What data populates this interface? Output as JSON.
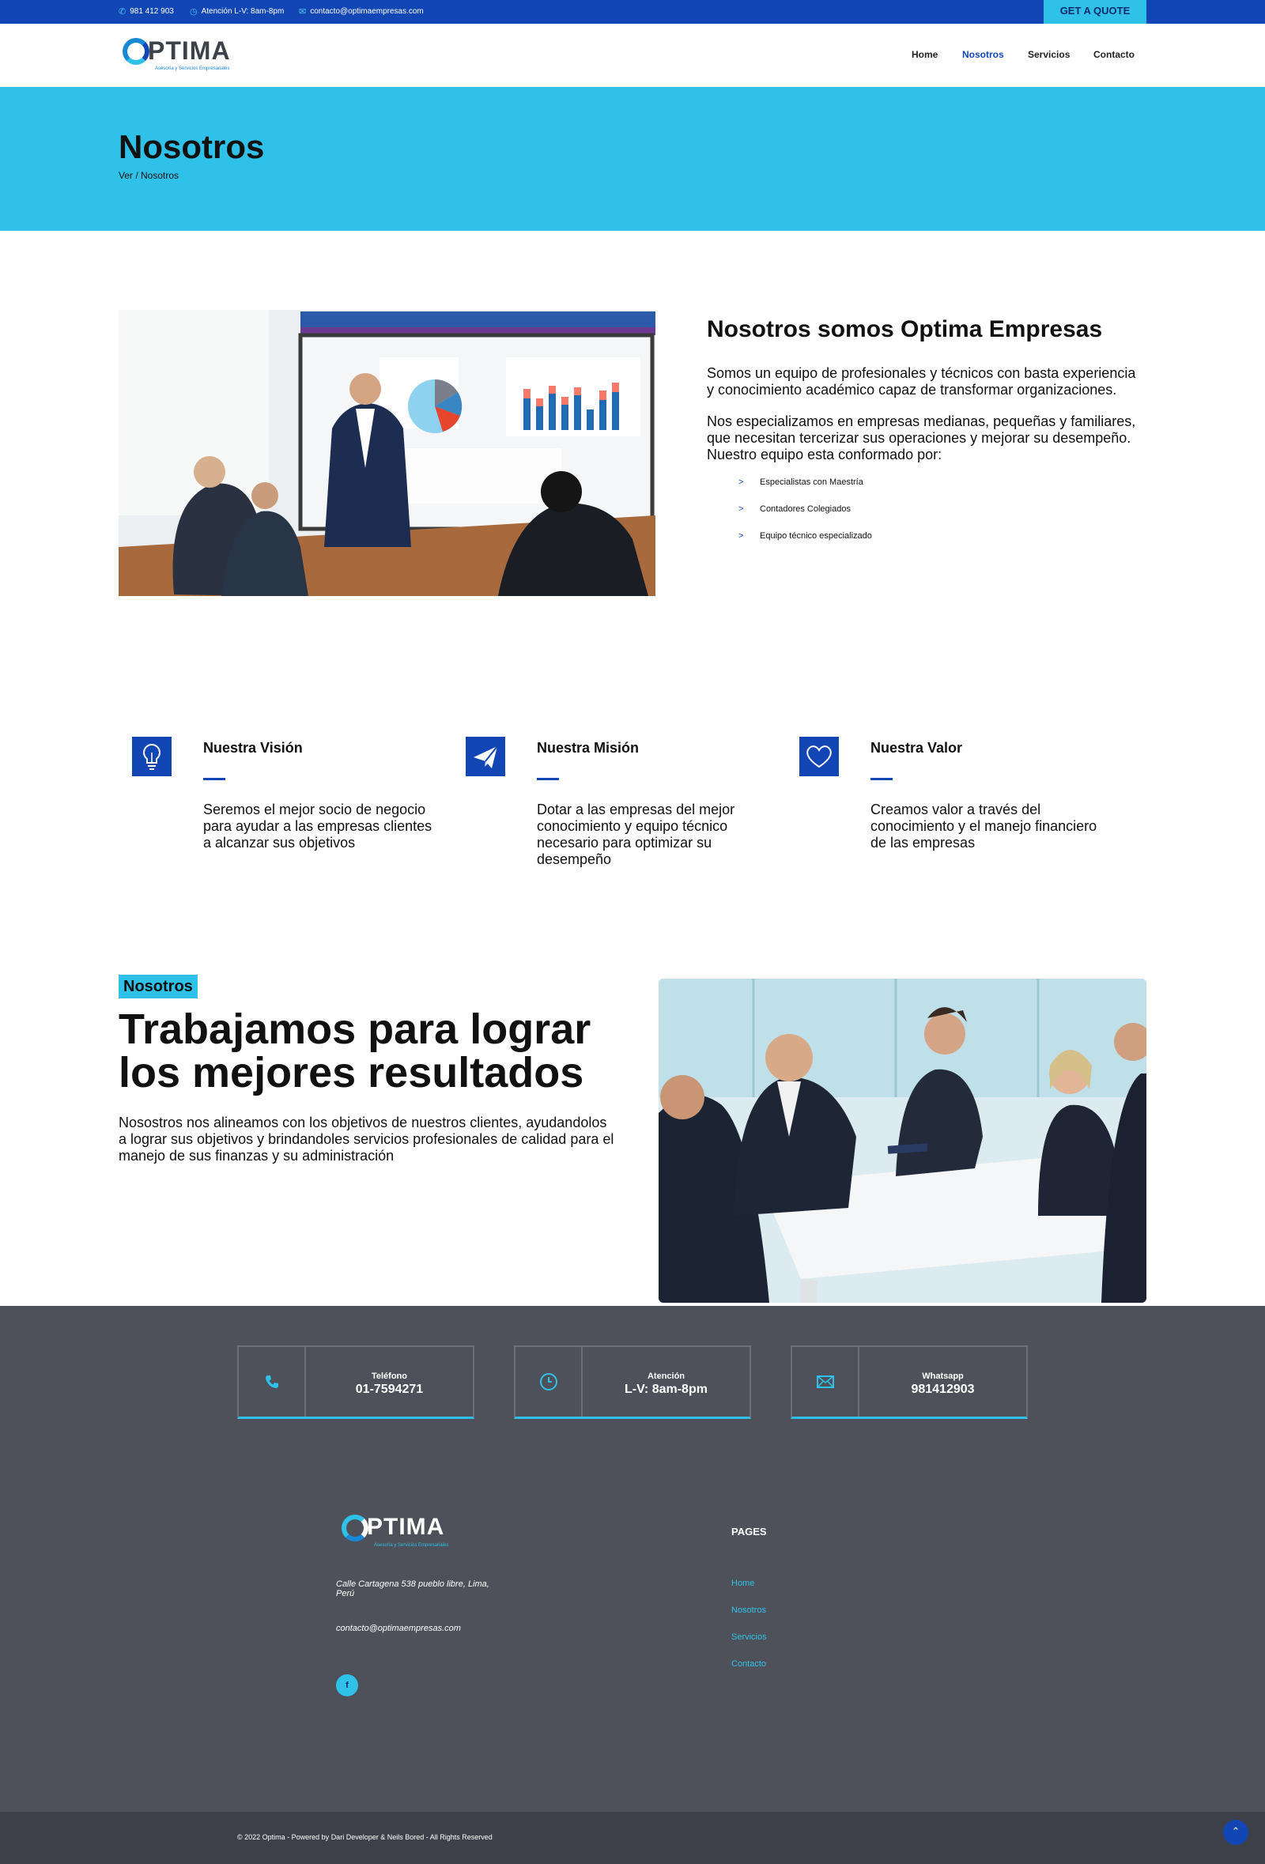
{
  "topbar": {
    "phone": "981 412 903",
    "hours": "Atención L-V: 8am-8pm",
    "email": "contacto@optimaempresas.com",
    "quote_button": "GET A QUOTE"
  },
  "brand": {
    "logo_text": "PTIMA",
    "tagline": "Asesoría y Servicios Empresariales"
  },
  "nav": {
    "items": [
      "Home",
      "Nosotros",
      "Servicios",
      "Contacto"
    ],
    "active": "Nosotros"
  },
  "hero": {
    "title": "Nosotros",
    "breadcrumb": "Ver / Nosotros"
  },
  "about": {
    "title": "Nosotros somos Optima Empresas",
    "p1": "Somos un equipo de profesionales y técnicos con basta experiencia y conocimiento académico capaz de transformar organizaciones.",
    "p2": "Nos especializamos en empresas medianas, pequeñas y familiares, que necesitan tercerizar sus operaciones y mejorar su desempeño. Nuestro equipo esta conformado por:",
    "list": [
      "Especialistas con Maestría",
      "Contadores Colegiados",
      "Equipo técnico especializado"
    ],
    "list_marker": ">"
  },
  "features": [
    {
      "icon": "lightbulb-icon",
      "title": "Nuestra Visión",
      "text": "Seremos el mejor socio de negocio para ayudar a las empresas clientes a alcanzar sus objetivos"
    },
    {
      "icon": "paper-plane-icon",
      "title": "Nuestra Misión",
      "text": "Dotar a las empresas del mejor conocimiento y equipo técnico necesario para optimizar su desempeño"
    },
    {
      "icon": "heart-icon",
      "title": "Nuestra Valor",
      "text": "Creamos valor a través del conocimiento y el manejo financiero de las empresas"
    }
  ],
  "work": {
    "tag": "Nosotros",
    "title": "Trabajamos para lograr los mejores resultados",
    "text": "Nosostros nos alineamos con los objetivos de nuestros clientes, ayudandolos a lograr sus objetivos y brindandoles servicios profesionales de calidad para el manejo de sus finanzas y su administración"
  },
  "contact_boxes": [
    {
      "icon": "phone-icon",
      "label": "Teléfono",
      "value": "01-7594271"
    },
    {
      "icon": "clock-icon",
      "label": "Atención",
      "value": "L-V: 8am-8pm"
    },
    {
      "icon": "mail-icon",
      "label": "Whatsapp",
      "value": "981412903"
    }
  ],
  "footer": {
    "address": "Calle Cartagena 538 pueblo libre, Lima, Perú",
    "email": "contacto@optimaempresas.com",
    "facebook": "f",
    "pages_title": "PAGES",
    "pages": [
      "Home",
      "Nosotros",
      "Servicios",
      "Contacto"
    ],
    "copyright": "© 2022 Optima - Powered by Dari Developer & Neils Bored - All Rights Reserved"
  },
  "colors": {
    "primary": "#1246b4",
    "accent": "#30c1e8",
    "footer": "#4e5159"
  }
}
